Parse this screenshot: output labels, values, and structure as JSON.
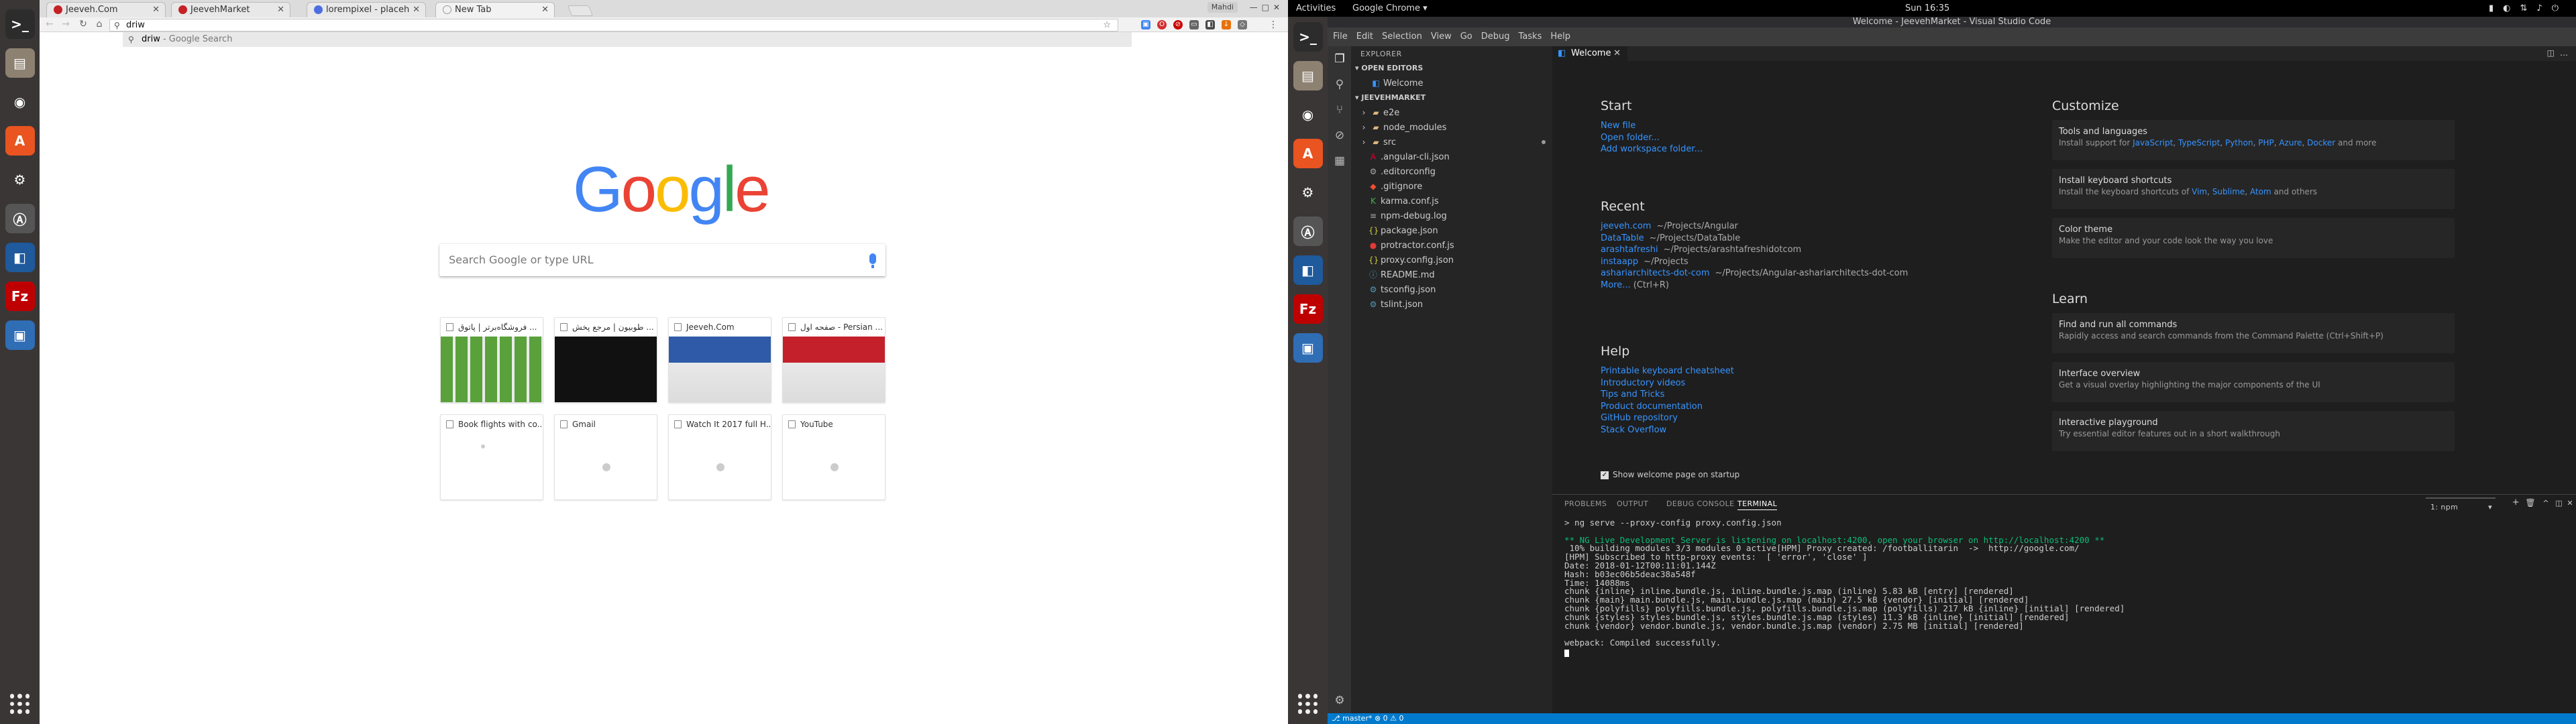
{
  "left_dock": {
    "apps": [
      {
        "icon": "terminal-icon",
        "bg": "#2c2c2c",
        "glyph": ">_"
      },
      {
        "icon": "files-icon",
        "bg": "#8d8171",
        "glyph": "▤"
      },
      {
        "icon": "chrome-icon",
        "bg": "#3a3636",
        "glyph": "◉"
      },
      {
        "icon": "software-center-icon",
        "bg": "#e95420",
        "glyph": "A"
      },
      {
        "icon": "settings-icon",
        "bg": "#3a3636",
        "glyph": "⚙"
      },
      {
        "icon": "software-updater-icon",
        "bg": "#555",
        "glyph": "Ⓐ"
      },
      {
        "icon": "vscode-icon",
        "bg": "#1e5a9c",
        "glyph": "◧"
      },
      {
        "icon": "filezilla-icon",
        "bg": "#bf0000",
        "glyph": "Fz"
      },
      {
        "icon": "virtualbox-icon",
        "bg": "#2f6db5",
        "glyph": "▣"
      }
    ]
  },
  "chrome": {
    "tabs": [
      {
        "label": "Jeeveh.Com",
        "fav": "#c52127"
      },
      {
        "label": "JeevehMarket",
        "fav": "#c52127"
      },
      {
        "label": "lorempixel - placeh",
        "fav": "#4d6ee2"
      },
      {
        "label": "New Tab",
        "fav": "#ffffff"
      }
    ],
    "profile": "Mahdi",
    "omnibox": {
      "value": "driw"
    },
    "suggestion": {
      "typed": "driw",
      "suffix": " - Google Search"
    },
    "search_placeholder": "Search Google or type URL",
    "logo": "Google",
    "tiles": [
      {
        "title": "فروشگاه‌برتر | پاتوق ...",
        "thumb": "#4f9c34"
      },
      {
        "title": "طوبیون | مرجع پخش ...",
        "thumb": "#1b1b1b"
      },
      {
        "title": "Jeeveh.Com",
        "thumb": "#2f5aa8"
      },
      {
        "title": "صفحه اول - Persian ...",
        "thumb": "#c4202c"
      },
      {
        "title": "Book flights with co...",
        "thumb": ""
      },
      {
        "title": "Gmail",
        "thumb": ""
      },
      {
        "title": "Watch It 2017 full H...",
        "thumb": ""
      },
      {
        "title": "YouTube",
        "thumb": ""
      }
    ]
  },
  "gnome": {
    "activities": "Activities",
    "app": "Google Chrome ▾",
    "clock": "Sun 16:35"
  },
  "vscode": {
    "title": "Welcome - JeevehMarket - Visual Studio Code",
    "menu": [
      "File",
      "Edit",
      "Selection",
      "View",
      "Go",
      "Debug",
      "Tasks",
      "Help"
    ],
    "explorer": "EXPLORER",
    "open_editors": "▾ OPEN EDITORS",
    "open_file": "Welcome",
    "project": "▾ JEEVEHMARKET",
    "files": [
      {
        "name": "e2e",
        "type": "folder",
        "color": "#dcb67a"
      },
      {
        "name": "node_modules",
        "type": "folder",
        "color": "#dcb67a"
      },
      {
        "name": "src",
        "type": "folder",
        "color": "#dcb67a"
      },
      {
        "name": ".angular-cli.json",
        "type": "file",
        "color": "#dd0031",
        "glyph": "A"
      },
      {
        "name": ".editorconfig",
        "type": "file",
        "color": "#aaa",
        "glyph": "⚙"
      },
      {
        "name": ".gitignore",
        "type": "file",
        "color": "#f14e32",
        "glyph": "◆"
      },
      {
        "name": "karma.conf.js",
        "type": "file",
        "color": "#4caf50",
        "glyph": "K"
      },
      {
        "name": "npm-debug.log",
        "type": "file",
        "color": "#aaa",
        "glyph": "≡"
      },
      {
        "name": "package.json",
        "type": "file",
        "color": "#cbcb41",
        "glyph": "{}"
      },
      {
        "name": "protractor.conf.js",
        "type": "file",
        "color": "#e53935",
        "glyph": "●"
      },
      {
        "name": "proxy.config.json",
        "type": "file",
        "color": "#cbcb41",
        "glyph": "{}"
      },
      {
        "name": "README.md",
        "type": "file",
        "color": "#519aba",
        "glyph": "ⓘ"
      },
      {
        "name": "tsconfig.json",
        "type": "file",
        "color": "#519aba",
        "glyph": "⚙"
      },
      {
        "name": "tslint.json",
        "type": "file",
        "color": "#519aba",
        "glyph": "⚙"
      }
    ],
    "tab": "Welcome",
    "welcome": {
      "start_h": "Start",
      "start": [
        "New file",
        "Open folder...",
        "Add workspace folder..."
      ],
      "recent_h": "Recent",
      "recent": [
        {
          "name": "jeeveh.com",
          "path": "~/Projects/Angular"
        },
        {
          "name": "DataTable",
          "path": "~/Projects/DataTable"
        },
        {
          "name": "arashtafreshi",
          "path": "~/Projects/arashtafreshidotcom"
        },
        {
          "name": "instaapp",
          "path": "~/Projects"
        },
        {
          "name": "ashariarchitects-dot-com",
          "path": "~/Projects/Angular-ashariarchitects-dot-com"
        }
      ],
      "more": "More...",
      "more_key": "(Ctrl+R)",
      "help_h": "Help",
      "help": [
        "Printable keyboard cheatsheet",
        "Introductory videos",
        "Tips and Tricks",
        "Product documentation",
        "GitHub repository",
        "Stack Overflow"
      ],
      "show_on_startup": "Show welcome page on startup",
      "customize_h": "Customize",
      "cards1": [
        {
          "t": "Tools and languages",
          "d": "Install support for ",
          "links": [
            "JavaScript",
            "TypeScript",
            "Python",
            "PHP",
            "Azure",
            "Docker"
          ],
          "tail": " and more"
        },
        {
          "t": "Install keyboard shortcuts",
          "d": "Install the keyboard shortcuts of ",
          "links": [
            "Vim",
            "Sublime",
            "Atom"
          ],
          "tail": " and others"
        },
        {
          "t": "Color theme",
          "d": "Make the editor and your code look the way you love",
          "links": [],
          "tail": ""
        }
      ],
      "learn_h": "Learn",
      "cards2": [
        {
          "t": "Find and run all commands",
          "d": "Rapidly access and search commands from the Command Palette (Ctrl+Shift+P)"
        },
        {
          "t": "Interface overview",
          "d": "Get a visual overlay highlighting the major components of the UI"
        },
        {
          "t": "Interactive playground",
          "d": "Try essential editor features out in a short walkthrough"
        }
      ]
    },
    "panel_tabs": [
      "PROBLEMS",
      "OUTPUT",
      "DEBUG CONSOLE",
      "TERMINAL"
    ],
    "terminal_select": "1: npm",
    "terminal": [
      {
        "t": "> ng serve --proxy-config proxy.config.json",
        "c": "#ccc"
      },
      {
        "t": "",
        "c": "#ccc"
      },
      {
        "t": "** NG Live Development Server is listening on localhost:4200, open your browser on http://localhost:4200 **",
        "c": "#0dbc79"
      },
      {
        "t": " 10% building modules 3/3 modules 0 active[HPM] Proxy created: /footballitarin  ->  http://google.com/",
        "c": "#ccc"
      },
      {
        "t": "[HPM] Subscribed to http-proxy events:  [ 'error', 'close' ]",
        "c": "#ccc"
      },
      {
        "t": "Date: 2018-01-12T00:11:01.144Z",
        "c": "#ccc"
      },
      {
        "t": "Hash: b03ec06b5deac38a548f",
        "c": "#ccc"
      },
      {
        "t": "Time: 14088ms",
        "c": "#ccc"
      },
      {
        "t": "chunk {inline} inline.bundle.js, inline.bundle.js.map (inline) 5.83 kB [entry] [rendered]",
        "c": "#ccc"
      },
      {
        "t": "chunk {main} main.bundle.js, main.bundle.js.map (main) 27.5 kB {vendor} [initial] [rendered]",
        "c": "#ccc"
      },
      {
        "t": "chunk {polyfills} polyfills.bundle.js, polyfills.bundle.js.map (polyfills) 217 kB {inline} [initial] [rendered]",
        "c": "#ccc"
      },
      {
        "t": "chunk {styles} styles.bundle.js, styles.bundle.js.map (styles) 11.3 kB {inline} [initial] [rendered]",
        "c": "#ccc"
      },
      {
        "t": "chunk {vendor} vendor.bundle.js, vendor.bundle.js.map (vendor) 2.75 MB [initial] [rendered]",
        "c": "#ccc"
      },
      {
        "t": "",
        "c": "#ccc"
      },
      {
        "t": "webpack: Compiled successfully.",
        "c": "#ccc"
      }
    ],
    "status": "⎇ master*  ⊗ 0  ⚠ 0"
  }
}
